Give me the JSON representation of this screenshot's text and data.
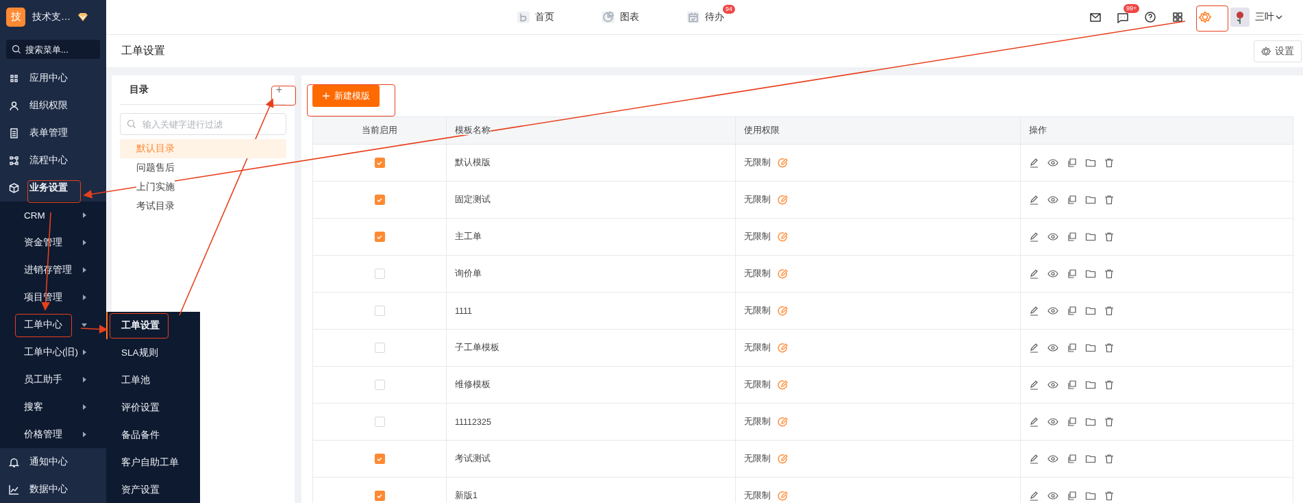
{
  "brand": {
    "logo": "技",
    "name": "技术支…"
  },
  "sidebar": {
    "search": {
      "placeholder": "搜索菜单..."
    },
    "items": [
      {
        "label": "应用中心",
        "expanded": false
      },
      {
        "label": "组织权限",
        "expanded": false
      },
      {
        "label": "表单管理",
        "expanded": false
      },
      {
        "label": "流程中心",
        "expanded": false
      },
      {
        "label": "业务设置",
        "expanded": true,
        "children": [
          {
            "label": "CRM",
            "expanded": false
          },
          {
            "label": "资金管理",
            "expanded": false
          },
          {
            "label": "进销存管理",
            "expanded": false
          },
          {
            "label": "项目管理",
            "expanded": false
          },
          {
            "label": "工单中心",
            "expanded": true
          },
          {
            "label": "工单中心(旧)",
            "expanded": false
          },
          {
            "label": "员工助手",
            "expanded": false
          },
          {
            "label": "搜客",
            "expanded": false
          },
          {
            "label": "价格管理",
            "expanded": false
          }
        ]
      },
      {
        "label": "通知中心",
        "expanded": false
      },
      {
        "label": "数据中心",
        "expanded": false
      }
    ]
  },
  "flyout": [
    {
      "label": "工单设置",
      "selected": true
    },
    {
      "label": "SLA规则",
      "selected": false
    },
    {
      "label": "工单池",
      "selected": false
    },
    {
      "label": "评价设置",
      "selected": false
    },
    {
      "label": "备品备件",
      "selected": false
    },
    {
      "label": "客户自助工单",
      "selected": false
    },
    {
      "label": "资产设置",
      "selected": false
    }
  ],
  "topnav": [
    {
      "label": "首页"
    },
    {
      "label": "图表"
    },
    {
      "label": "待办",
      "badge": "94"
    }
  ],
  "tools": [
    {
      "selected": false
    },
    {
      "badge": "99+",
      "selected": false
    },
    {
      "selected": false
    },
    {
      "selected": false
    },
    {
      "selected": true
    }
  ],
  "user": {
    "name": "三叶"
  },
  "page": {
    "title": "工单设置",
    "settings_button": "设置"
  },
  "directory": {
    "title": "目录",
    "add": "+",
    "filter": {
      "placeholder": "输入关键字进行过滤"
    },
    "items": [
      {
        "label": "默认目录",
        "selected": true
      },
      {
        "label": "问题售后",
        "selected": false
      },
      {
        "label": "上门实施",
        "selected": false
      },
      {
        "label": "考试目录",
        "selected": false
      }
    ]
  },
  "new_button": "新建模版",
  "table": {
    "columns": [
      "当前启用",
      "模板名称",
      "使用权限",
      "操作"
    ],
    "rows": [
      {
        "enabled": true,
        "name": "默认模版",
        "permission": "无限制"
      },
      {
        "enabled": true,
        "name": "固定测试",
        "permission": "无限制"
      },
      {
        "enabled": true,
        "name": "主工单",
        "permission": "无限制"
      },
      {
        "enabled": false,
        "name": "询价单",
        "permission": "无限制"
      },
      {
        "enabled": false,
        "name": "1111",
        "permission": "无限制"
      },
      {
        "enabled": false,
        "name": "子工单模板",
        "permission": "无限制"
      },
      {
        "enabled": false,
        "name": "维修模板",
        "permission": "无限制"
      },
      {
        "enabled": false,
        "name": "11112325",
        "permission": "无限制"
      },
      {
        "enabled": true,
        "name": "考试测试",
        "permission": "无限制"
      },
      {
        "enabled": true,
        "name": "新版1",
        "permission": "无限制"
      }
    ]
  }
}
